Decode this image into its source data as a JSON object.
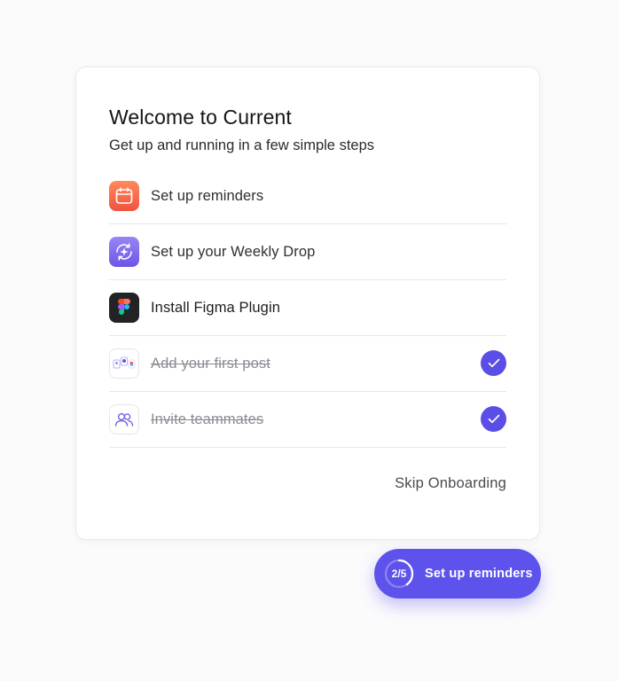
{
  "onboarding": {
    "title": "Welcome to Current",
    "subtitle": "Get up and running in a few simple steps",
    "steps": [
      {
        "label": "Set up reminders",
        "icon": "calendar-icon",
        "completed": false
      },
      {
        "label": "Set up your Weekly Drop",
        "icon": "weekly-drop-icon",
        "completed": false
      },
      {
        "label": "Install Figma Plugin",
        "icon": "figma-icon",
        "completed": false
      },
      {
        "label": "Add your first post",
        "icon": "post-collage-icon",
        "completed": true
      },
      {
        "label": "Invite teammates",
        "icon": "users-icon",
        "completed": true
      }
    ],
    "skip_label": "Skip Onboarding"
  },
  "progress_pill": {
    "progress_text": "2/5",
    "completed": 2,
    "total": 5,
    "label": "Set up reminders"
  },
  "colors": {
    "accent": "#5e52ec",
    "check": "#5b4ee6",
    "reminder_icon": "#f26a4b",
    "weekly_drop_icon": "#7d68ee",
    "figma_icon_bg": "#232326"
  }
}
